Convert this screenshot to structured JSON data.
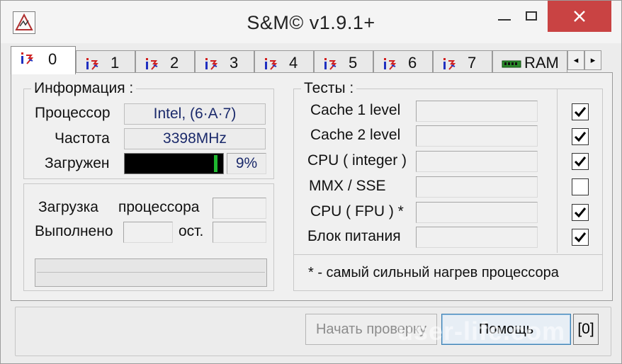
{
  "window": {
    "title": "S&M© v1.9.1+"
  },
  "tabs": [
    {
      "label": "0",
      "icon": "cpu-temp-icon",
      "active": true
    },
    {
      "label": "1",
      "icon": "cpu-temp-icon",
      "active": false
    },
    {
      "label": "2",
      "icon": "cpu-temp-icon",
      "active": false
    },
    {
      "label": "3",
      "icon": "cpu-temp-icon",
      "active": false
    },
    {
      "label": "4",
      "icon": "cpu-temp-icon",
      "active": false
    },
    {
      "label": "5",
      "icon": "cpu-temp-icon",
      "active": false
    },
    {
      "label": "6",
      "icon": "cpu-temp-icon",
      "active": false
    },
    {
      "label": "7",
      "icon": "cpu-temp-icon",
      "active": false
    },
    {
      "label": "RAM",
      "icon": "memory-module-icon",
      "active": false
    }
  ],
  "tab_scroll": {
    "left": "◂",
    "right": "▸"
  },
  "info": {
    "legend": "Информация :",
    "cpu_label": "Процессор",
    "cpu_value": "Intel, (6·A·7)",
    "freq_label": "Частота",
    "freq_value": "3398MHz",
    "load_label": "Загружен",
    "load_percent": 9,
    "load_text": "9%",
    "load_color": "#1fb830"
  },
  "progress": {
    "load_label_1": "Загрузка",
    "load_label_2": "процессора",
    "load_value": "",
    "done_label": "Выполнено",
    "done_value": "",
    "rest_label": "ост.",
    "rest_value": "",
    "bar_value": 0
  },
  "tests": {
    "legend": "Тесты :",
    "items": [
      {
        "label": "Cache 1 level",
        "value": "",
        "checked": true
      },
      {
        "label": "Cache 2 level",
        "value": "",
        "checked": true
      },
      {
        "label": "CPU ( integer )",
        "value": "",
        "checked": true
      },
      {
        "label": "MMX / SSE",
        "value": "",
        "checked": false
      },
      {
        "label": "CPU ( FPU ) *",
        "value": "",
        "checked": true
      },
      {
        "label": "Блок питания",
        "value": "",
        "checked": true
      }
    ],
    "footnote": "* - самый сильный нагрев процессора"
  },
  "buttons": {
    "start": "Начать проверку",
    "help": "Помощь",
    "counter": "[0]"
  },
  "watermark": "user-life.com"
}
